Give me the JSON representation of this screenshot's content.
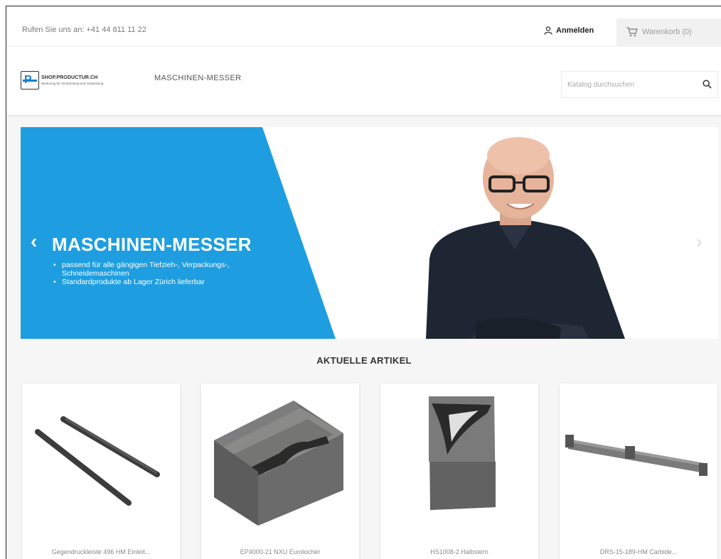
{
  "header": {
    "phone": "Rufen Sie uns an: +41 44 811 11 22",
    "login_label": "Anmelden",
    "cart_label": "Warenkorb (0)"
  },
  "logo": {
    "name": "SHOP.PRODUCTUR.CH",
    "tagline": "Werkzeug für Verarbeitung und Verpackung"
  },
  "nav": {
    "items": [
      "MASCHINEN-MESSER"
    ]
  },
  "search": {
    "placeholder": "Katalog durchsuchen"
  },
  "hero": {
    "title": "MASCHINEN-MESSER",
    "bullets": [
      "passend für alle gängigen Tiefzieh-, Verpackungs-, Schneidemaschinen",
      "Standardprodukte ab Lager Zürich lieferbar"
    ],
    "accent_color": "#1e9ee0"
  },
  "featured": {
    "title": "AKTUELLE ARTIKEL",
    "products": [
      {
        "name": "Gegendruckleiste 496 HM Einleit...",
        "icon": "bar-rods-image"
      },
      {
        "name": "EP4000-21 NXU Eurolocher",
        "icon": "euro-punch-image"
      },
      {
        "name": "HS1008-2 Halbstern",
        "icon": "half-star-punch-image"
      },
      {
        "name": "DRS-15-189-HM Carbide...",
        "icon": "carbide-bar-image"
      }
    ]
  }
}
